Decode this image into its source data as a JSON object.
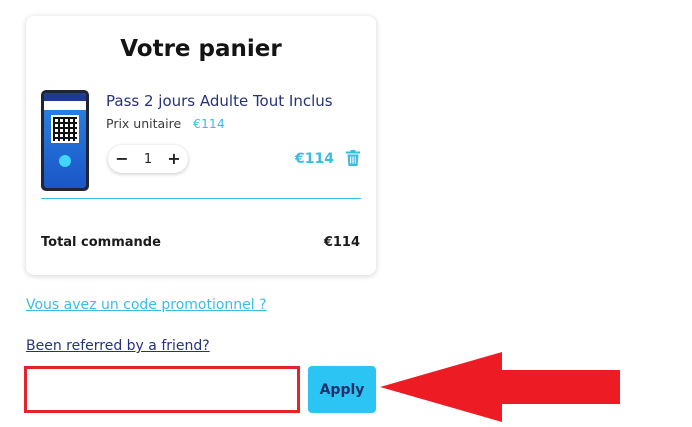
{
  "cart": {
    "title": "Votre panier",
    "item": {
      "name": "Pass 2 jours Adulte Tout Inclus",
      "unit_label": "Prix unitaire",
      "unit_price": "€114",
      "quantity": "1",
      "line_total": "€114",
      "decrement_symbol": "−",
      "increment_symbol": "+"
    },
    "total_label": "Total commande",
    "total_value": "€114"
  },
  "promo": {
    "promo_link": "Vous avez un code promotionnel ?",
    "referral_link": "Been referred by a friend?",
    "code_value": "",
    "apply_label": "Apply"
  },
  "colors": {
    "accent": "#3bbde3",
    "brand_dark": "#26327a",
    "apply_bg": "#2cc5f3",
    "annotation_red": "#e3242b"
  },
  "icons": {
    "trash": "trash-icon",
    "phone": "phone-ticket-illustration",
    "arrow": "red-arrow-annotation"
  }
}
